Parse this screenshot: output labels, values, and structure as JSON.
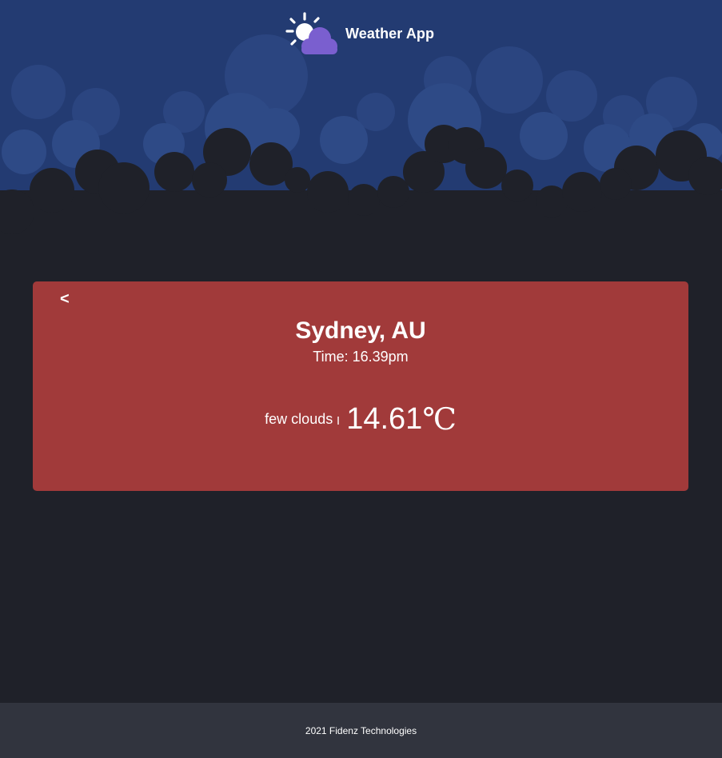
{
  "header": {
    "title": "Weather App",
    "logo_icon": "sun-cloud-icon"
  },
  "colors": {
    "sky": "#233b72",
    "sky_clouds": "#2c4680",
    "background": "#1f2129",
    "card": "#a13a3a",
    "footer": "#31343e",
    "logo_cloud": "#7a5fcf"
  },
  "weather": {
    "back_label": "<",
    "city": "Sydney, AU",
    "time": "Time: 16.39pm",
    "description": "few clouds",
    "temperature": "14.61",
    "unit": "℃"
  },
  "footer": {
    "copyright": "2021 Fidenz Technologies"
  }
}
